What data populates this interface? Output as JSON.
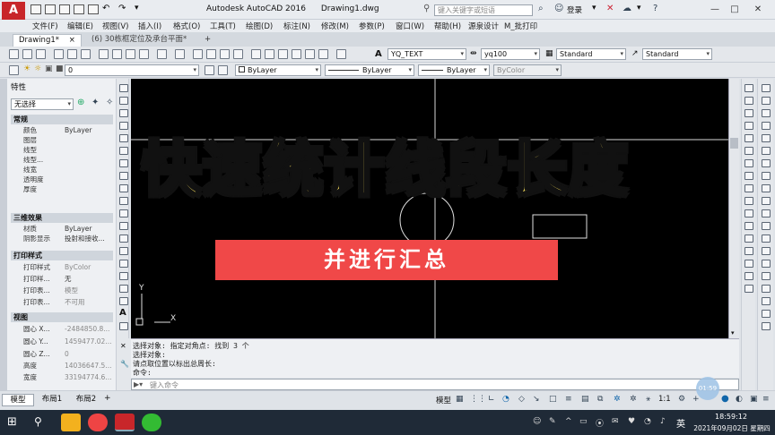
{
  "titlebar": {
    "logo": "A",
    "app_title": "Autodesk AutoCAD 2016",
    "file_name": "Drawing1.dwg",
    "search_placeholder": "键入关键字或短语",
    "login": "登录"
  },
  "menu": [
    "文件(F)",
    "编辑(E)",
    "视图(V)",
    "插入(I)",
    "格式(O)",
    "工具(T)",
    "绘图(D)",
    "标注(N)",
    "修改(M)",
    "参数(P)",
    "窗口(W)",
    "帮助(H)",
    "源泉设计",
    "M_批打印"
  ],
  "tabs": [
    {
      "label": "Drawing1*"
    },
    {
      "label": "(6) 30栋框定位及承台平面*"
    }
  ],
  "toolbar": {
    "text_style": "YQ_TEXT",
    "dim_style": "yq100",
    "table_style": "Standard",
    "mleader_style": "Standard",
    "layer": "0",
    "color": "ByLayer",
    "linetype": "ByLayer",
    "lineweight": "ByLayer",
    "plotstyle": "ByColor"
  },
  "properties": {
    "title": "特性",
    "selection": "无选择",
    "sections": [
      {
        "name": "常规",
        "rows": [
          {
            "k": "颜色",
            "v": "ByLayer"
          },
          {
            "k": "图层",
            "v": ""
          },
          {
            "k": "线型",
            "v": ""
          },
          {
            "k": "线型...",
            "v": ""
          },
          {
            "k": "线宽",
            "v": ""
          },
          {
            "k": "透明度",
            "v": ""
          },
          {
            "k": "厚度",
            "v": ""
          }
        ]
      },
      {
        "name": "三维效果",
        "rows": [
          {
            "k": "材质",
            "v": "ByLayer"
          },
          {
            "k": "阴影显示",
            "v": "投射和接收..."
          }
        ]
      },
      {
        "name": "打印样式",
        "rows": [
          {
            "k": "打印样式",
            "v": "ByColor"
          },
          {
            "k": "打印样...",
            "v": "无"
          },
          {
            "k": "打印表...",
            "v": "模型"
          },
          {
            "k": "打印表...",
            "v": "不可用"
          }
        ]
      },
      {
        "name": "视图",
        "rows": [
          {
            "k": "圆心 X...",
            "v": "-2484850.8..."
          },
          {
            "k": "圆心 Y...",
            "v": "1459477.02..."
          },
          {
            "k": "圆心 Z...",
            "v": "0"
          },
          {
            "k": "高度",
            "v": "14036647.5..."
          },
          {
            "k": "宽度",
            "v": "33194774.6..."
          }
        ]
      }
    ]
  },
  "banner": {
    "main": "快速统计线段长度",
    "sub": "并进行汇总"
  },
  "axis": {
    "y": "Y",
    "x": "X"
  },
  "command": {
    "history": [
      "选择对象: 指定对角点: 找到 3 个",
      "选择对象:",
      "请点取位置以标出总周长:",
      "命令:"
    ],
    "placeholder": "键入命令"
  },
  "layout_tabs": [
    "模型",
    "布局1",
    "布局2"
  ],
  "status": {
    "model": "模型",
    "scale": "1:1",
    "timer": "01:59"
  },
  "taskbar": {
    "time": "18:59:12",
    "date": "2021年09月02日 星期四",
    "ime": "英"
  },
  "colors": {
    "banner_yellow": "#ffe45c",
    "banner_red": "#f04848",
    "canvas": "#000000"
  }
}
